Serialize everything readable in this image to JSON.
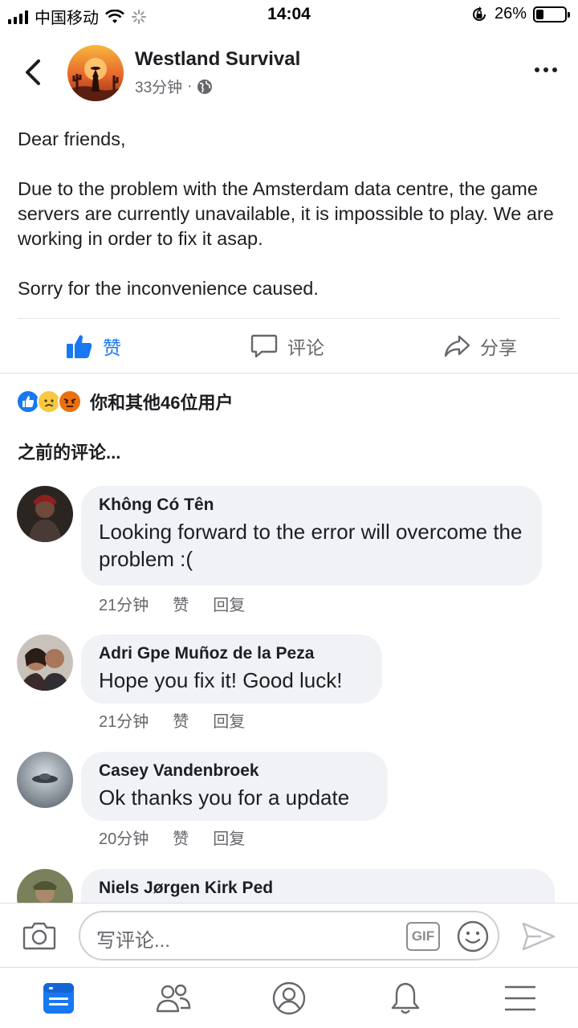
{
  "status_bar": {
    "carrier": "中国移动",
    "time": "14:04",
    "battery": "26%",
    "battery_level": 0.26
  },
  "header": {
    "page_name": "Westland Survival",
    "time_ago": "33分钟",
    "separator": "·"
  },
  "post": {
    "paragraphs": [
      "Dear friends,",
      "Due to the problem with the Amsterdam data centre, the game servers are currently unavailable, it is impossible to play. We are working in order to fix it asap.",
      "Sorry for the inconvenience caused."
    ]
  },
  "actions": {
    "like": "赞",
    "comment": "评论",
    "share": "分享"
  },
  "reactions": {
    "summary": "你和其他46位用户",
    "types": [
      "like",
      "sad",
      "angry"
    ]
  },
  "previous_comments": "之前的评论...",
  "comments": [
    {
      "name": "Không Có Tên",
      "text": "Looking forward to the error will overcome the problem :(",
      "time": "21分钟",
      "like": "赞",
      "reply": "回复"
    },
    {
      "name": "Adri Gpe Muñoz de la Peza",
      "text": "Hope you fix it! Good luck!",
      "time": "21分钟",
      "like": "赞",
      "reply": "回复"
    },
    {
      "name": "Casey Vandenbroek",
      "text": "Ok thanks you for a update",
      "time": "20分钟",
      "like": "赞",
      "reply": "回复"
    },
    {
      "name": "Niels Jørgen Kirk Ped",
      "text": "",
      "time": "",
      "like": "",
      "reply": ""
    }
  ],
  "compose": {
    "placeholder": "写评论...",
    "gif": "GIF"
  },
  "tabs": [
    "news-feed",
    "friends",
    "profile",
    "notifications",
    "menu"
  ],
  "colors": {
    "accent": "#1877f2",
    "bubble": "#f0f2f5",
    "secondary_text": "#65676b"
  }
}
